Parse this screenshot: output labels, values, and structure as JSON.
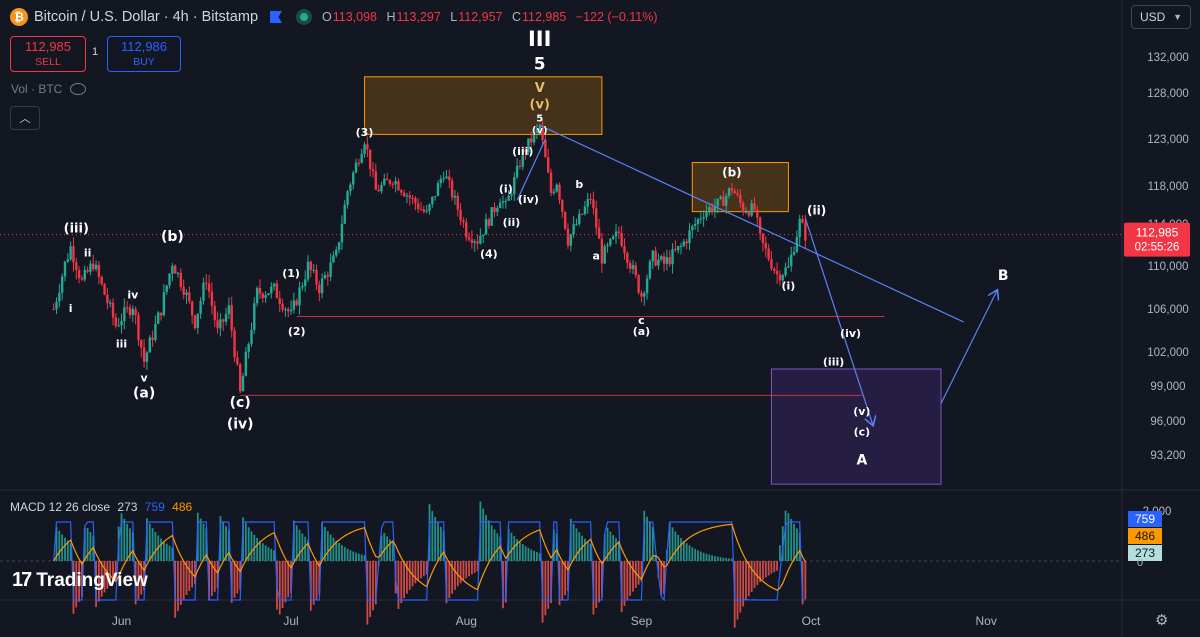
{
  "header": {
    "title": "Bitcoin / U.S. Dollar · 4h · Bitstamp",
    "btc_icon": "bitcoin-icon",
    "o_label": "O",
    "o_value": "113,098",
    "h_label": "H",
    "h_value": "113,297",
    "l_label": "L",
    "l_value": "112,957",
    "c_label": "C",
    "c_value": "112,985",
    "change": "−122 (−0.11%)"
  },
  "trade": {
    "sell_price": "112,985",
    "sell_label": "SELL",
    "qty": "1",
    "buy_price": "112,986",
    "buy_label": "BUY"
  },
  "volume_label": "Vol · BTC",
  "currency": "USD",
  "price_badge": {
    "price": "112,985",
    "countdown": "02:55:26"
  },
  "macd": {
    "label": "MACD 12 26 close",
    "hist": "273",
    "macd": "759",
    "signal": "486",
    "badges": [
      "759",
      "486",
      "273"
    ],
    "top_tick": "2,000",
    "zero_tick": "0"
  },
  "brand": "TradingView",
  "colors": {
    "up": "#22ab94",
    "down": "#f23645",
    "background": "#131722",
    "macd_line": "#2962ff",
    "signal_line": "#ff9800",
    "projection": "#5b82f5"
  },
  "chart_data": {
    "type": "candlestick",
    "x_ticks": [
      "Jun",
      "Jul",
      "Aug",
      "Sep",
      "Oct",
      "Nov"
    ],
    "y_ticks": [
      132000,
      128000,
      123000,
      118000,
      114000,
      110000,
      106000,
      102000,
      99000,
      96000,
      93200
    ],
    "ylim": [
      90500,
      135000
    ],
    "current_price": 112985,
    "price_path": [
      {
        "d": "2025-05-20",
        "p": 106000
      },
      {
        "d": "2025-05-22",
        "p": 110200
      },
      {
        "d": "2025-05-23",
        "p": 111800
      },
      {
        "d": "2025-05-25",
        "p": 108500
      },
      {
        "d": "2025-05-27",
        "p": 110300
      },
      {
        "d": "2025-05-31",
        "p": 104500
      },
      {
        "d": "2025-06-01",
        "p": 105200
      },
      {
        "d": "2025-06-03",
        "p": 106400
      },
      {
        "d": "2025-06-05",
        "p": 101200
      },
      {
        "d": "2025-06-08",
        "p": 106000
      },
      {
        "d": "2025-06-10",
        "p": 110400
      },
      {
        "d": "2025-06-12",
        "p": 108000
      },
      {
        "d": "2025-06-14",
        "p": 104800
      },
      {
        "d": "2025-06-16",
        "p": 108900
      },
      {
        "d": "2025-06-18",
        "p": 103800
      },
      {
        "d": "2025-06-20",
        "p": 106000
      },
      {
        "d": "2025-06-22",
        "p": 98300
      },
      {
        "d": "2025-06-25",
        "p": 107500
      },
      {
        "d": "2025-06-28",
        "p": 107800
      },
      {
        "d": "2025-07-01",
        "p": 105400
      },
      {
        "d": "2025-07-04",
        "p": 110000
      },
      {
        "d": "2025-07-06",
        "p": 108000
      },
      {
        "d": "2025-07-09",
        "p": 111000
      },
      {
        "d": "2025-07-11",
        "p": 117500
      },
      {
        "d": "2025-07-14",
        "p": 123000
      },
      {
        "d": "2025-07-16",
        "p": 117500
      },
      {
        "d": "2025-07-19",
        "p": 118800
      },
      {
        "d": "2025-07-22",
        "p": 116800
      },
      {
        "d": "2025-07-25",
        "p": 115000
      },
      {
        "d": "2025-07-28",
        "p": 119500
      },
      {
        "d": "2025-08-01",
        "p": 113300
      },
      {
        "d": "2025-08-03",
        "p": 112500
      },
      {
        "d": "2025-08-05",
        "p": 114500
      },
      {
        "d": "2025-08-07",
        "p": 116800
      },
      {
        "d": "2025-08-08",
        "p": 115800
      },
      {
        "d": "2025-08-10",
        "p": 119500
      },
      {
        "d": "2025-08-11",
        "p": 121500
      },
      {
        "d": "2025-08-14",
        "p": 124300
      },
      {
        "d": "2025-08-16",
        "p": 117300
      },
      {
        "d": "2025-08-17",
        "p": 118500
      },
      {
        "d": "2025-08-19",
        "p": 112500
      },
      {
        "d": "2025-08-21",
        "p": 114500
      },
      {
        "d": "2025-08-23",
        "p": 116800
      },
      {
        "d": "2025-08-25",
        "p": 110800
      },
      {
        "d": "2025-08-28",
        "p": 113200
      },
      {
        "d": "2025-09-01",
        "p": 107300
      },
      {
        "d": "2025-09-03",
        "p": 110800
      },
      {
        "d": "2025-09-05",
        "p": 110200
      },
      {
        "d": "2025-09-08",
        "p": 111800
      },
      {
        "d": "2025-09-12",
        "p": 115300
      },
      {
        "d": "2025-09-15",
        "p": 116200
      },
      {
        "d": "2025-09-17",
        "p": 117800
      },
      {
        "d": "2025-09-19",
        "p": 115600
      },
      {
        "d": "2025-09-21",
        "p": 115500
      },
      {
        "d": "2025-09-22",
        "p": 112500
      },
      {
        "d": "2025-09-25",
        "p": 109200
      },
      {
        "d": "2025-09-27",
        "p": 109800
      },
      {
        "d": "2025-09-29",
        "p": 114200
      },
      {
        "d": "2025-09-30",
        "p": 112985
      }
    ],
    "horizontal_levels": [
      {
        "from": "2025-07-02",
        "to": "2025-10-14",
        "p": 105300,
        "color": "#f23645"
      },
      {
        "from": "2025-06-22",
        "to": "2025-10-10",
        "p": 98200,
        "color": "#f23645"
      }
    ],
    "zones": [
      {
        "from": "2025-07-14",
        "to": "2025-08-25",
        "p_top": 129800,
        "p_bottom": 123500,
        "kind": "orange"
      },
      {
        "from": "2025-09-10",
        "to": "2025-09-27",
        "p_top": 120500,
        "p_bottom": 115300,
        "kind": "orange"
      },
      {
        "from": "2025-09-24",
        "to": "2025-10-24",
        "p_top": 100500,
        "p_bottom": 90800,
        "kind": "purple"
      }
    ],
    "projection_lines": [
      {
        "from": "2025-08-14",
        "p1": 124500,
        "to": "2025-10-28",
        "p2": 104800
      },
      {
        "from": "2025-09-30",
        "p1": 114600,
        "to": "2025-10-12",
        "p2": 95600
      },
      {
        "from": "2025-10-24",
        "p1": 97500,
        "to": "2025-11-03",
        "p2": 107800
      },
      {
        "from": "2025-08-10",
        "p1": 116500,
        "to": "2025-08-15",
        "p2": 123000
      }
    ],
    "annotations": [
      {
        "t": "III",
        "d": "2025-08-14",
        "p": 133200,
        "size": 21,
        "bold": true
      },
      {
        "t": "5",
        "d": "2025-08-14",
        "p": 130600,
        "size": 17,
        "bold": true
      },
      {
        "t": "V",
        "d": "2025-08-14",
        "p": 128100,
        "size": 13,
        "bold": true,
        "color": "#e6c16a"
      },
      {
        "t": "(v)",
        "d": "2025-08-14",
        "p": 126300,
        "size": 13,
        "bold": true,
        "color": "#e6c16a"
      },
      {
        "t": "5",
        "d": "2025-08-14",
        "p": 124900,
        "size": 10
      },
      {
        "t": "(v)",
        "d": "2025-08-14",
        "p": 123600,
        "size": 10
      },
      {
        "t": "(3)",
        "d": "2025-07-14",
        "p": 123300,
        "size": 11
      },
      {
        "t": "(iii)",
        "d": "2025-08-11",
        "p": 121300,
        "size": 11
      },
      {
        "t": "(i)",
        "d": "2025-08-08",
        "p": 117300,
        "size": 11
      },
      {
        "t": "(iv)",
        "d": "2025-08-12",
        "p": 116200,
        "size": 11
      },
      {
        "t": "(ii)",
        "d": "2025-08-09",
        "p": 113800,
        "size": 11
      },
      {
        "t": "(4)",
        "d": "2025-08-05",
        "p": 110800,
        "size": 11
      },
      {
        "t": "b",
        "d": "2025-08-21",
        "p": 117800,
        "size": 11
      },
      {
        "t": "a",
        "d": "2025-08-24",
        "p": 110600,
        "size": 11
      },
      {
        "t": "c",
        "d": "2025-09-01",
        "p": 104600,
        "size": 11
      },
      {
        "t": "(a)",
        "d": "2025-09-01",
        "p": 103600,
        "size": 11
      },
      {
        "t": "(b)",
        "d": "2025-09-17",
        "p": 119000,
        "size": 12
      },
      {
        "t": "(ii)",
        "d": "2025-10-02",
        "p": 115000,
        "size": 12
      },
      {
        "t": "(i)",
        "d": "2025-09-27",
        "p": 107800,
        "size": 11
      },
      {
        "t": "(iv)",
        "d": "2025-10-08",
        "p": 103400,
        "size": 11
      },
      {
        "t": "(iii)",
        "d": "2025-10-05",
        "p": 100800,
        "size": 11
      },
      {
        "t": "(v)",
        "d": "2025-10-10",
        "p": 96500,
        "size": 11
      },
      {
        "t": "(c)",
        "d": "2025-10-10",
        "p": 94800,
        "size": 11
      },
      {
        "t": "A",
        "d": "2025-10-10",
        "p": 92400,
        "size": 14
      },
      {
        "t": "B",
        "d": "2025-11-04",
        "p": 108700,
        "size": 14
      },
      {
        "t": "(1)",
        "d": "2025-07-01",
        "p": 109000,
        "size": 11
      },
      {
        "t": "(2)",
        "d": "2025-07-02",
        "p": 103600,
        "size": 11
      },
      {
        "t": "(iii)",
        "d": "2025-05-24",
        "p": 113200,
        "size": 13
      },
      {
        "t": "ii",
        "d": "2025-05-26",
        "p": 110900,
        "size": 11
      },
      {
        "t": "i",
        "d": "2025-05-23",
        "p": 105700,
        "size": 11
      },
      {
        "t": "iv",
        "d": "2025-06-03",
        "p": 107000,
        "size": 11
      },
      {
        "t": "iii",
        "d": "2025-06-01",
        "p": 102400,
        "size": 11
      },
      {
        "t": "v",
        "d": "2025-06-05",
        "p": 99400,
        "size": 11
      },
      {
        "t": "(a)",
        "d": "2025-06-05",
        "p": 98000,
        "size": 14
      },
      {
        "t": "(b)",
        "d": "2025-06-10",
        "p": 112400,
        "size": 14
      },
      {
        "t": "(c)",
        "d": "2025-06-22",
        "p": 97200,
        "size": 14
      },
      {
        "t": "(iv)",
        "d": "2025-06-22",
        "p": 95400,
        "size": 14
      }
    ]
  }
}
